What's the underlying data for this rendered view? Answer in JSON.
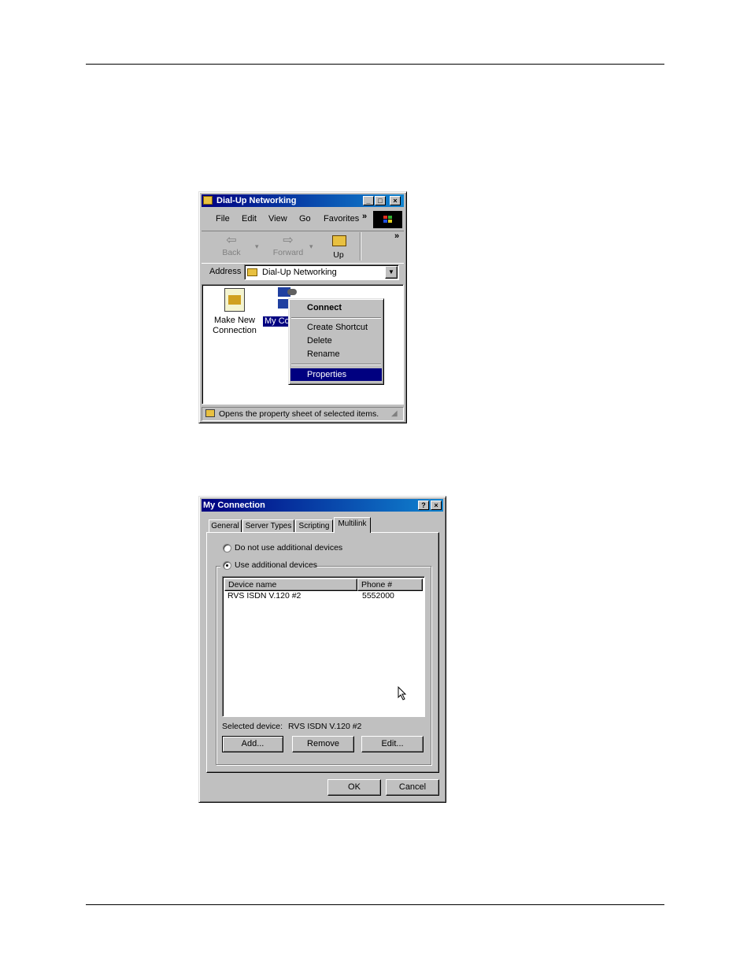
{
  "explorer": {
    "title": "Dial-Up Networking",
    "menu": [
      "File",
      "Edit",
      "View",
      "Go",
      "Favorites"
    ],
    "menu_more": "»",
    "toolbar": {
      "back": "Back",
      "forward": "Forward",
      "up": "Up",
      "more": "»"
    },
    "address_label": "Address",
    "address_value": "Dial-Up Networking",
    "icons": [
      {
        "label_line1": "Make New",
        "label_line2": "Connection"
      },
      {
        "label": "My Co"
      }
    ],
    "context_menu": [
      "Connect",
      "Create Shortcut",
      "Delete",
      "Rename",
      "Properties"
    ],
    "status": "Opens the property sheet of selected items."
  },
  "dialog": {
    "title": "My Connection",
    "help_btn": "?",
    "close_btn": "×",
    "tabs": [
      "General",
      "Server Types",
      "Scripting",
      "Multilink"
    ],
    "radio_no": "Do not use additional devices",
    "radio_use": "Use additional devices",
    "columns": [
      "Device name",
      "Phone #"
    ],
    "rows": [
      {
        "device": "RVS ISDN V.120 #2",
        "phone": "5552000"
      }
    ],
    "selected_label": "Selected device:",
    "selected_value": "RVS ISDN V.120 #2",
    "buttons": {
      "add": "Add...",
      "remove": "Remove",
      "edit": "Edit...",
      "ok": "OK",
      "cancel": "Cancel"
    }
  }
}
